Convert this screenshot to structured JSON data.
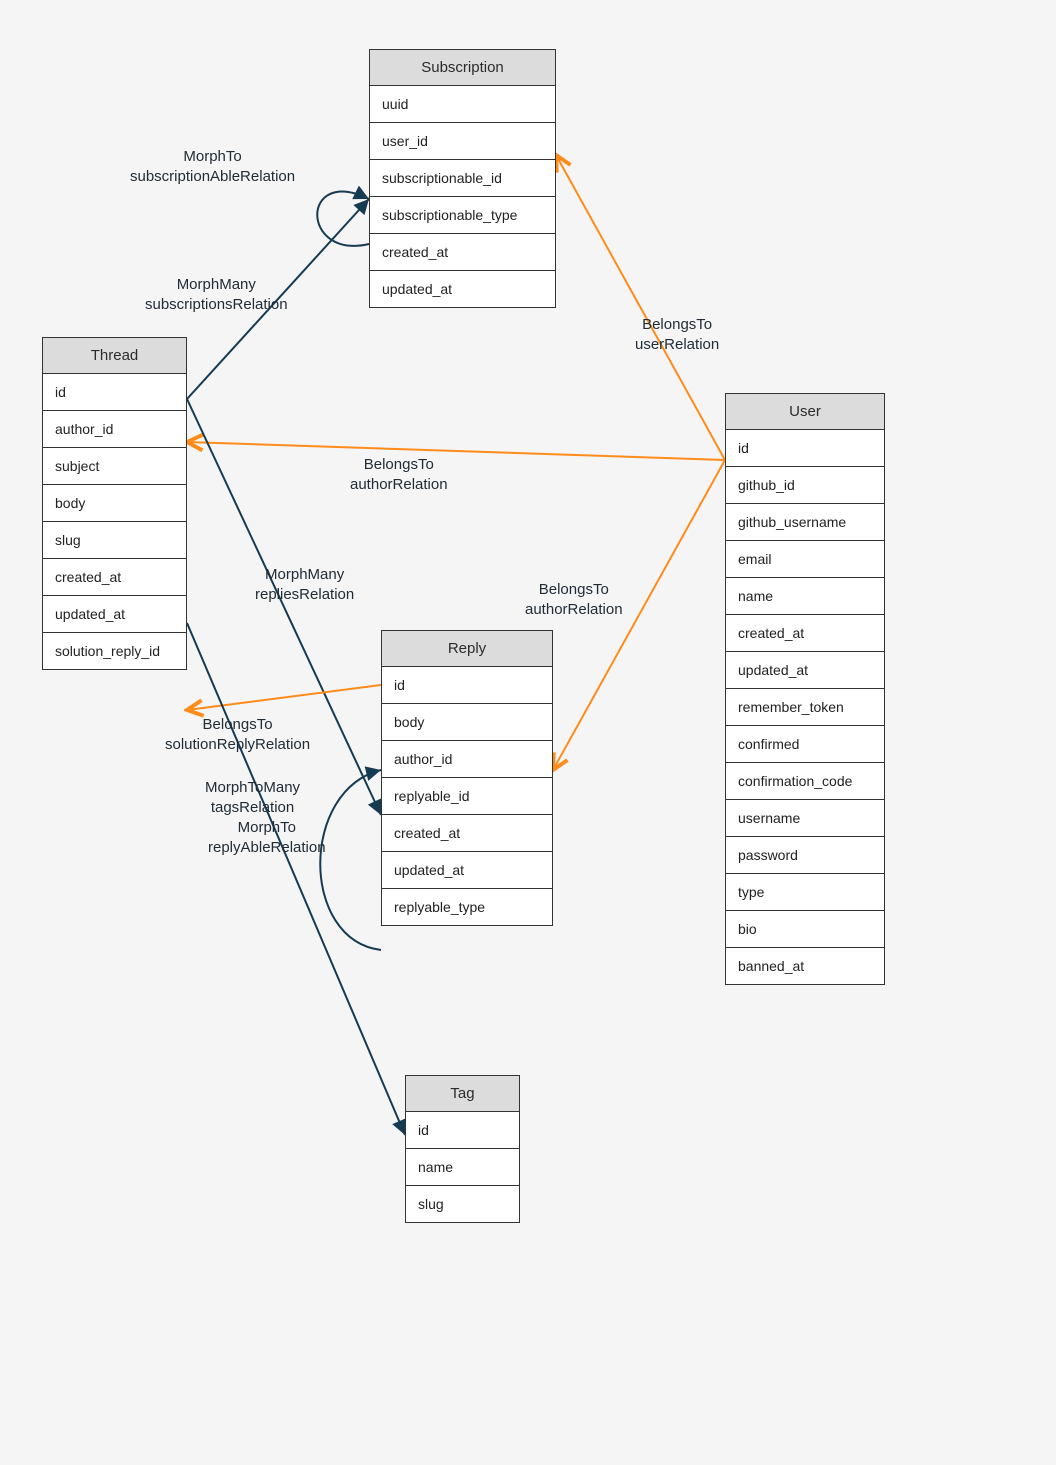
{
  "entities": {
    "subscription": {
      "title": "Subscription",
      "fields": [
        "uuid",
        "user_id",
        "subscriptionable_id",
        "subscriptionable_type",
        "created_at",
        "updated_at"
      ]
    },
    "thread": {
      "title": "Thread",
      "fields": [
        "id",
        "author_id",
        "subject",
        "body",
        "slug",
        "created_at",
        "updated_at",
        "solution_reply_id"
      ]
    },
    "user": {
      "title": "User",
      "fields": [
        "id",
        "github_id",
        "github_username",
        "email",
        "name",
        "created_at",
        "updated_at",
        "remember_token",
        "confirmed",
        "confirmation_code",
        "username",
        "password",
        "type",
        "bio",
        "banned_at"
      ]
    },
    "reply": {
      "title": "Reply",
      "fields": [
        "id",
        "body",
        "author_id",
        "replyable_id",
        "created_at",
        "updated_at",
        "replyable_type"
      ]
    },
    "tag": {
      "title": "Tag",
      "fields": [
        "id",
        "name",
        "slug"
      ]
    }
  },
  "relations": {
    "morphto_subscriptionable": {
      "l1": "MorphTo",
      "l2": "subscriptionAbleRelation"
    },
    "morphmany_subscriptions": {
      "l1": "MorphMany",
      "l2": "subscriptionsRelation"
    },
    "belongsto_user": {
      "l1": "BelongsTo",
      "l2": "userRelation"
    },
    "belongsto_author_thread": {
      "l1": "BelongsTo",
      "l2": "authorRelation"
    },
    "belongsto_author_reply": {
      "l1": "BelongsTo",
      "l2": "authorRelation"
    },
    "morphmany_replies": {
      "l1": "MorphMany",
      "l2": "repliesRelation"
    },
    "belongsto_solutionreply": {
      "l1": "BelongsTo",
      "l2": "solutionReplyRelation"
    },
    "morphtomany_tags": {
      "l1": "MorphToMany",
      "l2": "tagsRelation"
    },
    "morphto_replyable": {
      "l1": "MorphTo",
      "l2": "replyAbleRelation"
    }
  },
  "colors": {
    "navy": "#153b53",
    "orange": "#ff8c1a"
  }
}
